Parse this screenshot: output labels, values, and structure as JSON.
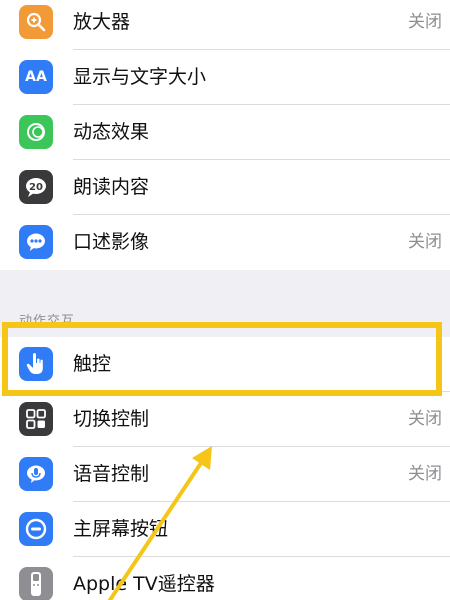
{
  "rows": [
    {
      "label": "放大器",
      "value": "关闭",
      "icon": "magnifier-icon",
      "color": "#f29a38"
    },
    {
      "label": "显示与文字大小",
      "value": "",
      "icon": "text-size-icon",
      "color": "#2f7cf6"
    },
    {
      "label": "动态效果",
      "value": "",
      "icon": "motion-icon",
      "color": "#3cc65a"
    },
    {
      "label": "朗读内容",
      "value": "",
      "icon": "speech-icon",
      "color": "#3a3a3c"
    },
    {
      "label": "口述影像",
      "value": "关闭",
      "icon": "audio-description-icon",
      "color": "#2f7cf6"
    },
    {
      "label": "触控",
      "value": "",
      "icon": "touch-icon",
      "color": "#2f7cf6"
    },
    {
      "label": "切换控制",
      "value": "关闭",
      "icon": "switch-control-icon",
      "color": "#3a3a3c"
    },
    {
      "label": "语音控制",
      "value": "关闭",
      "icon": "voice-control-icon",
      "color": "#2f7cf6"
    },
    {
      "label": "主屏幕按钮",
      "value": "",
      "icon": "home-button-icon",
      "color": "#2f7cf6"
    },
    {
      "label": "Apple TV遥控器",
      "value": "",
      "icon": "apple-tv-remote-icon",
      "color": "#8e8e93"
    }
  ],
  "section_header": "动作交互",
  "accent": "#f5c518",
  "icon_glyphs": {
    "text_size": "AA",
    "speech": "20"
  }
}
